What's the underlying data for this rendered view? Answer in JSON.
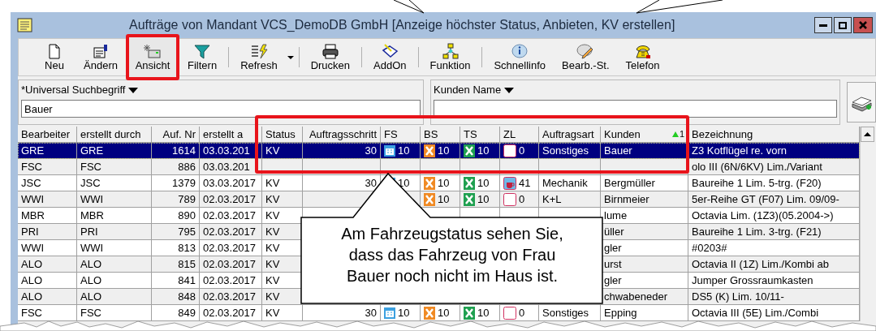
{
  "window": {
    "title": "Aufträge von Mandant  VCS_DemoDB GmbH [Anzeige höchster Status, Anbieten, KV erstellen]"
  },
  "toolbar": [
    {
      "kind": "button",
      "label": "Neu",
      "highlighted": false
    },
    {
      "kind": "button",
      "label": "Ändern",
      "highlighted": false
    },
    {
      "kind": "button",
      "label": "Ansicht",
      "highlighted": true
    },
    {
      "kind": "button",
      "label": "Filtern",
      "highlighted": false
    },
    {
      "kind": "separator"
    },
    {
      "kind": "button",
      "label": "Refresh",
      "highlighted": false,
      "dropdown": true
    },
    {
      "kind": "separator"
    },
    {
      "kind": "button",
      "label": "Drucken",
      "highlighted": false
    },
    {
      "kind": "separator"
    },
    {
      "kind": "button",
      "label": "AddOn",
      "highlighted": false
    },
    {
      "kind": "separator"
    },
    {
      "kind": "button",
      "label": "Funktion",
      "highlighted": false
    },
    {
      "kind": "separator"
    },
    {
      "kind": "button",
      "label": "Schnellinfo",
      "highlighted": false
    },
    {
      "kind": "button",
      "label": "Bearb.-St.",
      "highlighted": false
    },
    {
      "kind": "button",
      "label": "Telefon",
      "highlighted": false
    }
  ],
  "search": [
    {
      "label": "*Universal Suchbegriff",
      "value": "Bauer"
    },
    {
      "label": "Kunden Name"
    }
  ],
  "table": {
    "columns": [
      {
        "label": "Bearbeiter"
      },
      {
        "label": "erstellt durch"
      },
      {
        "label": "Auf. Nr"
      },
      {
        "label": "erstellt a"
      },
      {
        "label": "Status"
      },
      {
        "label": "Auftragsschritt"
      },
      {
        "label": "FS"
      },
      {
        "label": "BS"
      },
      {
        "label": "TS"
      },
      {
        "label": "ZL"
      },
      {
        "label": "Auftragsart"
      },
      {
        "label": "Kunden",
        "sort": "1"
      },
      {
        "label": "Bezeichnung"
      }
    ],
    "rows": [
      {
        "selected": true,
        "cells": [
          "GRE",
          "GRE",
          "1614",
          "03.03.201",
          "KV",
          "30",
          "10",
          "10",
          "10",
          {
            "text": "0",
            "kind": "empty"
          },
          "Sonstiges",
          "Bauer",
          "Z3 Kotflügel re. vorn"
        ]
      },
      {
        "selected": false,
        "cells": [
          "FSC",
          "FSC",
          "886",
          "03.03.201",
          null,
          null,
          null,
          null,
          null,
          null,
          null,
          null,
          "olo III (6N/6KV) Lim./Variant"
        ]
      },
      {
        "selected": false,
        "cells": [
          "JSC",
          "JSC",
          "1379",
          "03.03.2017",
          "KV",
          "30",
          "10",
          "10",
          "10",
          {
            "text": "41",
            "kind": "cup"
          },
          "Mechanik",
          "Bergmüller",
          "Baureihe 1 Lim. 5-trg. (F20)"
        ]
      },
      {
        "selected": false,
        "cells": [
          "WWI",
          "WWI",
          "789",
          "02.03.2017",
          "KV",
          null,
          null,
          "10",
          "10",
          {
            "text": "0",
            "kind": "empty"
          },
          "K+L",
          "Birnmeier",
          "5er-Reihe GT (F07) Lim. 09/09-"
        ]
      },
      {
        "selected": false,
        "cells": [
          "MBR",
          "MBR",
          "890",
          "02.03.2017",
          "KV",
          null,
          null,
          null,
          null,
          null,
          null,
          "lume",
          "Octavia Lim. (1Z3)(05.2004->)"
        ]
      },
      {
        "selected": false,
        "cells": [
          "PRI",
          "PRI",
          "795",
          "02.03.2017",
          "KV",
          null,
          null,
          null,
          null,
          null,
          null,
          "üller",
          "Baureihe 1 Lim. 3-trg. (F21)"
        ]
      },
      {
        "selected": false,
        "cells": [
          "WWI",
          "WWI",
          "813",
          "02.03.2017",
          "KV",
          null,
          null,
          null,
          null,
          null,
          null,
          "gler",
          "#0203#"
        ]
      },
      {
        "selected": false,
        "cells": [
          "ALO",
          "ALO",
          "815",
          "02.03.2017",
          "KV",
          null,
          null,
          null,
          null,
          null,
          null,
          "urst",
          "Octavia II (1Z) Lim./Kombi ab"
        ]
      },
      {
        "selected": false,
        "cells": [
          "ALO",
          "ALO",
          "841",
          "02.03.2017",
          "KV",
          null,
          null,
          null,
          null,
          null,
          null,
          "gler",
          "Jumper Grossraumkasten"
        ]
      },
      {
        "selected": false,
        "cells": [
          "ALO",
          "ALO",
          "848",
          "02.03.2017",
          "KV",
          null,
          null,
          null,
          null,
          null,
          null,
          "chwabeneder",
          "DS5 (K) Lim. 10/11-"
        ]
      },
      {
        "selected": false,
        "cells": [
          "FSC",
          "FSC",
          "849",
          "02.03.2017",
          "KV",
          "30",
          "10",
          "10",
          "10",
          {
            "text": "0",
            "kind": "empty"
          },
          "Sonstiges",
          "Epping",
          "Octavia III (5E) Lim./Combi"
        ]
      }
    ]
  },
  "callout": {
    "text": "Am Fahrzeugstatus sehen Sie,\ndass das Fahrzeug von Frau\nBauer noch nicht im Haus ist."
  }
}
